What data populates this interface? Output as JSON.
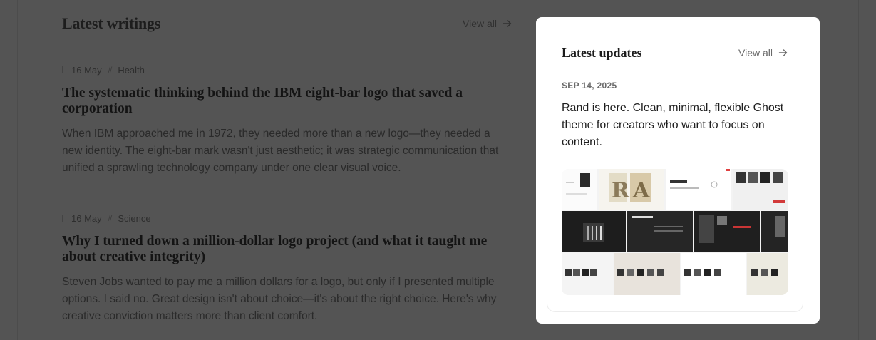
{
  "writings": {
    "title": "Latest writings",
    "view_all": "View all",
    "posts": [
      {
        "date": "16 May",
        "separator": "//",
        "category": "Health",
        "title": "The systematic thinking behind the IBM eight-bar logo that saved a corporation",
        "excerpt": "When IBM approached me in 1972, they needed more than a new logo—they needed a new identity. The eight-bar mark wasn't just aesthetic; it was strategic communication that unified a sprawling technology company under one clear visual voice."
      },
      {
        "date": "16 May",
        "separator": "//",
        "category": "Science",
        "title": "Why I turned down a million-dollar logo project (and what it taught me about creative integrity)",
        "excerpt": "Steven Jobs wanted to pay me a million dollars for a logo, but only if I presented multiple options. I said no. Great design isn't about choice—it's about the right choice. Here's why creative conviction matters more than client comfort."
      }
    ]
  },
  "updates": {
    "title": "Latest updates",
    "view_all": "View all",
    "date": "SEP 14, 2025",
    "text": "Rand is here. Clean, minimal, flexible Ghost theme for creators who want to focus on content.",
    "image_icon": "theme-preview-collage"
  },
  "icons": {
    "view_all_arrow": "arrow-right-icon"
  },
  "colors": {
    "overlay_background": "#545454",
    "card_background": "#ffffff",
    "heading_text": "#1d1d1d"
  }
}
